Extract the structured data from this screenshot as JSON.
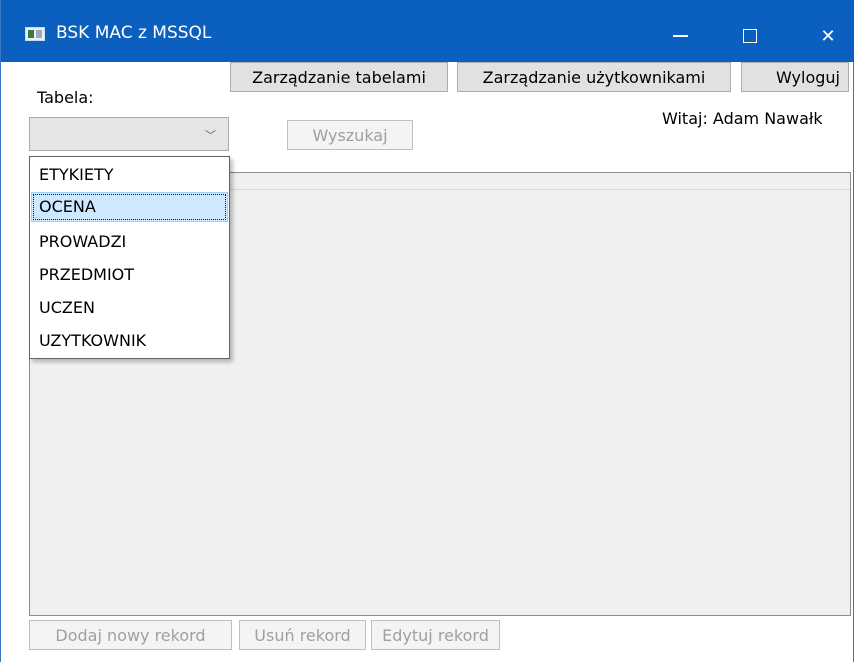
{
  "window": {
    "title": "BSK MAC z MSSQL"
  },
  "toolbar": {
    "manage_tables": "Zarządzanie tabelami",
    "manage_users": "Zarządzanie użytkownikami",
    "logout": "Wyloguj"
  },
  "search": {
    "table_label": "Tabela:",
    "search_button": "Wyszukaj"
  },
  "greeting": "Witaj: Adam Nawałk",
  "dropdown": {
    "items": [
      "ETYKIETY",
      "OCENA",
      "PROWADZI",
      "PRZEDMIOT",
      "UCZEN",
      "UZYTKOWNIK"
    ],
    "highlighted": "OCENA"
  },
  "actions": {
    "add": "Dodaj nowy rekord",
    "delete": "Usuń rekord",
    "edit": "Edytuj rekord"
  },
  "icons": {
    "app": "app-icon",
    "minimize": "minimize-icon",
    "maximize": "maximize-icon",
    "close": "close-icon",
    "combo_arrow": "chevron-down-icon"
  },
  "colors": {
    "titlebar": "#0b5fbf",
    "selection": "#cde8ff"
  }
}
